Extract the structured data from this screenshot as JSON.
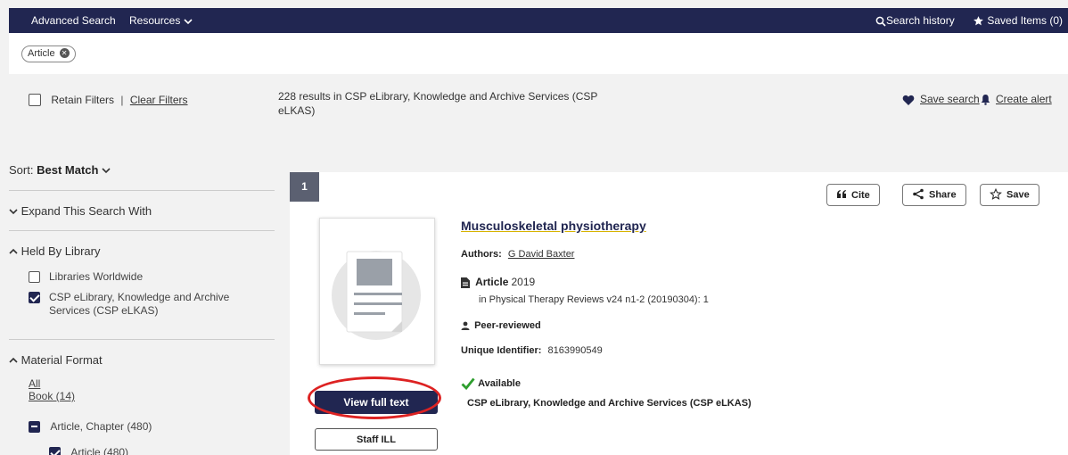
{
  "nav": {
    "advanced_search": "Advanced Search",
    "resources": "Resources",
    "search_history": "Search history",
    "saved_items": "Saved Items (0)"
  },
  "chip": {
    "label": "Article"
  },
  "toolbar": {
    "retain_filters": "Retain Filters",
    "separator": "|",
    "clear_filters": "Clear Filters",
    "results_summary": "228 results in CSP eLibrary, Knowledge and Archive Services (CSP eLKAS)",
    "save_search": "Save search",
    "create_alert": "Create alert"
  },
  "sidebar": {
    "sort_label": "Sort:",
    "sort_value": "Best Match",
    "expand_heading": "Expand This Search With",
    "held_heading": "Held By Library",
    "held_options": [
      {
        "label": "Libraries Worldwide",
        "checked": false
      },
      {
        "label": "CSP eLibrary, Knowledge and Archive Services (CSP eLKAS)",
        "checked": true
      }
    ],
    "format_heading": "Material Format",
    "format_all": "All",
    "format_book": "Book (14)",
    "format_article_chapter": "Article, Chapter (480)",
    "format_article": "Article (480)"
  },
  "result": {
    "index": "1",
    "title": "Musculoskeletal physiotherapy",
    "authors_label": "Authors:",
    "author": "G David Baxter",
    "type": "Article",
    "year": "2019",
    "source": "in Physical Therapy Reviews v24 n1-2 (20190304): 1",
    "peer_reviewed": "Peer-reviewed",
    "uid_label": "Unique Identifier:",
    "uid": "8163990549",
    "availability": "Available",
    "library": "CSP eLibrary, Knowledge and Archive Services (CSP eLKAS)",
    "view_full_text": "View full text",
    "staff_ill": "Staff ILL",
    "cite": "Cite",
    "share": "Share",
    "save": "Save"
  },
  "colors": {
    "nav_bg": "#212651",
    "primary": "#212651",
    "available_green": "#2e9e2e",
    "annotation_red": "#dd2222"
  }
}
